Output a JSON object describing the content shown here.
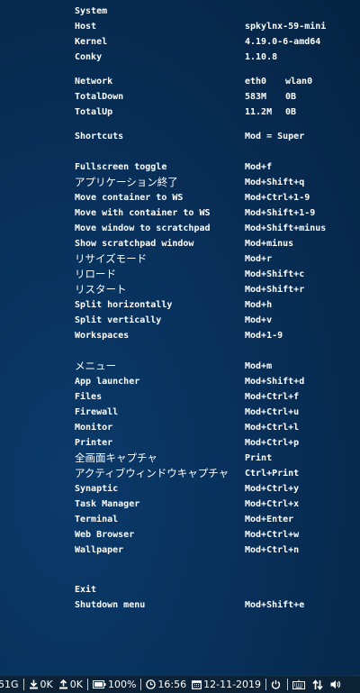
{
  "system": {
    "heading": "System",
    "host_label": "Host",
    "host_value": "spkylnx-59-mini",
    "kernel_label": "Kernel",
    "kernel_value": "4.19.0-6-amd64",
    "conky_label": "Conky",
    "conky_value": "1.10.8"
  },
  "network": {
    "label": "Network",
    "iface1": "eth0",
    "iface2": "wlan0",
    "down_label": "TotalDown",
    "down_eth0": "583M",
    "down_wlan0": "0B",
    "up_label": "TotalUp",
    "up_eth0": "11.2M",
    "up_wlan0": "0B"
  },
  "shortcuts_header": {
    "label": "Shortcuts",
    "value": "Mod = Super"
  },
  "shortcuts_group1": [
    {
      "action": "Fullscreen toggle",
      "keys": "Mod+f"
    },
    {
      "action": "アプリケーション終了",
      "keys": "Mod+Shift+q",
      "jp": true
    },
    {
      "action": "Move container to WS",
      "keys": "Mod+Ctrl+1-9"
    },
    {
      "action": "Move with container to WS",
      "keys": "Mod+Shift+1-9"
    },
    {
      "action": "Move window to scratchpad",
      "keys": "Mod+Shift+minus"
    },
    {
      "action": "Show scratchpad window",
      "keys": "Mod+minus"
    },
    {
      "action": "リサイズモード",
      "keys": "Mod+r",
      "jp": true
    },
    {
      "action": "リロード",
      "keys": "Mod+Shift+c",
      "jp": true
    },
    {
      "action": "リスタート",
      "keys": "Mod+Shift+r",
      "jp": true
    },
    {
      "action": "Split horizontally",
      "keys": "Mod+h"
    },
    {
      "action": "Split vertically",
      "keys": "Mod+v"
    },
    {
      "action": "Workspaces",
      "keys": "Mod+1-9"
    }
  ],
  "shortcuts_group2": [
    {
      "action": "メニュー",
      "keys": "Mod+m",
      "jp": true
    },
    {
      "action": "App launcher",
      "keys": "Mod+Shift+d"
    },
    {
      "action": "Files",
      "keys": "Mod+Ctrl+f"
    },
    {
      "action": "Firewall",
      "keys": "Mod+Ctrl+u"
    },
    {
      "action": "Monitor",
      "keys": "Mod+Ctrl+l"
    },
    {
      "action": "Printer",
      "keys": "Mod+Ctrl+p"
    },
    {
      "action": "全画面キャプチャ",
      "keys": "Print",
      "jp": true
    },
    {
      "action": "アクティブウィンドウキャプチャ",
      "keys": "Ctrl+Print",
      "jp": true
    },
    {
      "action": "Synaptic",
      "keys": "Mod+Ctrl+y"
    },
    {
      "action": "Task Manager",
      "keys": "Mod+Ctrl+x"
    },
    {
      "action": "Terminal",
      "keys": "Mod+Enter"
    },
    {
      "action": "Web Browser",
      "keys": "Mod+Ctrl+w"
    },
    {
      "action": "Wallpaper",
      "keys": "Mod+Ctrl+n"
    }
  ],
  "exit": {
    "exit_label": "Exit",
    "shutdown_label": "Shutdown menu",
    "shutdown_keys": "Mod+Shift+e"
  },
  "taskbar": {
    "disk_fragment": "51G",
    "download": "0K",
    "upload": "0K",
    "battery": "100%",
    "time": "16:56",
    "date": "12-11-2019",
    "icons": [
      "download-icon",
      "upload-icon",
      "battery-icon",
      "clock-icon",
      "calendar-icon",
      "power-icon",
      "keyboard-icon",
      "network-arrows-icon",
      "volume-icon"
    ]
  },
  "colors": {
    "background": "#08315c",
    "text": "#ffffff",
    "taskbar": "#0c2236"
  }
}
